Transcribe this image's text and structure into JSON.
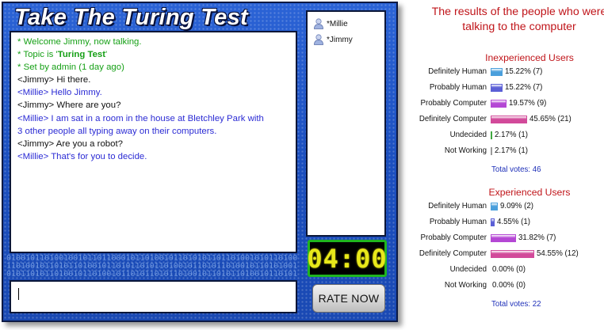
{
  "app": {
    "title": "Take The Turing Test",
    "chat": [
      {
        "kind": "system",
        "text": "* Welcome Jimmy, now talking."
      },
      {
        "kind": "system",
        "text": "* Topic is '",
        "bold": "Turing Test",
        "after": "'"
      },
      {
        "kind": "system",
        "text": "* Set by admin (1 day ago)"
      },
      {
        "kind": "jimmy",
        "text": "<Jimmy> Hi there."
      },
      {
        "kind": "millie",
        "text": "<Millie> Hello Jimmy."
      },
      {
        "kind": "jimmy",
        "text": "<Jimmy> Where are you?"
      },
      {
        "kind": "millie",
        "text": "<Millie> I am sat in a room in the house at Bletchley Park with\n3 other people all typing away on their computers."
      },
      {
        "kind": "jimmy",
        "text": "<Jimmy> Are you a robot?"
      },
      {
        "kind": "millie",
        "text": "<Millie> That's for you to decide."
      }
    ],
    "users": [
      "*Millie",
      "*Jimmy"
    ],
    "timer": "04:00",
    "rate_button": "RATE NOW",
    "input_value": ""
  },
  "results": {
    "title": "The results of the people who were talking to the computer",
    "colors": {
      "Definitely Human": "#4a9fdc",
      "Probably Human": "#5b5fd6",
      "Probably Computer": "#b447d4",
      "Definitely Computer": "#d24a9a",
      "Undecided": "#3fa83f",
      "Not Working": "#9a9a9a"
    },
    "groups": [
      {
        "title": "Inexperienced Users",
        "rows": [
          {
            "label": "Definitely Human",
            "pct": 15.22,
            "text": "15.22% (7)"
          },
          {
            "label": "Probably Human",
            "pct": 15.22,
            "text": "15.22% (7)"
          },
          {
            "label": "Probably Computer",
            "pct": 19.57,
            "text": "19.57% (9)"
          },
          {
            "label": "Definitely Computer",
            "pct": 45.65,
            "text": "45.65% (21)"
          },
          {
            "label": "Undecided",
            "pct": 2.17,
            "text": "2.17% (1)"
          },
          {
            "label": "Not Working",
            "pct": 2.17,
            "text": "2.17% (1)"
          }
        ],
        "total": "Total votes: 46"
      },
      {
        "title": "Experienced Users",
        "rows": [
          {
            "label": "Definitely Human",
            "pct": 9.09,
            "text": "9.09% (2)"
          },
          {
            "label": "Probably Human",
            "pct": 4.55,
            "text": "4.55% (1)"
          },
          {
            "label": "Probably Computer",
            "pct": 31.82,
            "text": "31.82% (7)"
          },
          {
            "label": "Definitely Computer",
            "pct": 54.55,
            "text": "54.55% (12)"
          },
          {
            "label": "Undecided",
            "pct": 0,
            "text": "0.00% (0)"
          },
          {
            "label": "Not Working",
            "pct": 0,
            "text": "0.00% (0)"
          }
        ],
        "total": "Total votes: 22"
      }
    ]
  }
}
